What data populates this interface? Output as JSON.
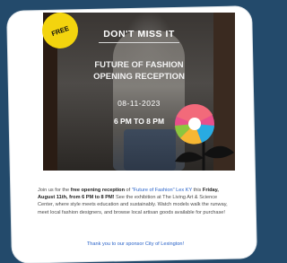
{
  "badge": "FREE",
  "poster": {
    "dont_miss": "DON'T MISS IT",
    "title_line1": "FUTURE OF FASHION",
    "title_line2": "OPENING RECEPTION",
    "date": "08-11-2023",
    "time": "6 PM TO 8 PM"
  },
  "body": {
    "p1": "Join us for the ",
    "p2": "free opening reception",
    "p3": " of ",
    "p4": "\"Future of Fashion\" Lex KY",
    "p5": " this ",
    "p6": "Friday, August 11th, from 6 PM to 8 PM!",
    "p7": " See the exhibition at The Living Art & Science Center, where style meets education and sustainably. Watch models walk the runway, meet local fashion designers, and browse local artisan goods available for purchase!"
  },
  "thanks": "Thank you to our sponsor City of Lexington!",
  "colors": {
    "background": "#234a6b",
    "badge": "#f3d40e",
    "link": "#2a63c8"
  }
}
